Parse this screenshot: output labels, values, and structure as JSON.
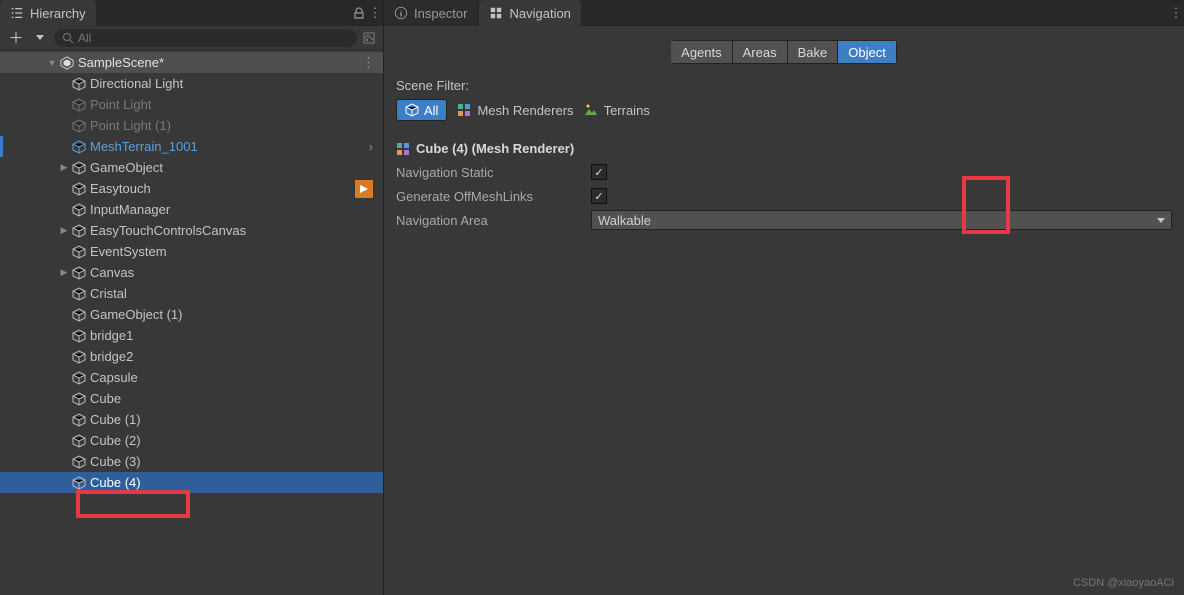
{
  "hierarchy": {
    "title": "Hierarchy",
    "search_placeholder": "All",
    "scene": "SampleScene*",
    "items": [
      {
        "label": "Directional Light",
        "indent": 2,
        "dim": false,
        "blue": false,
        "arrow": "",
        "mark": false
      },
      {
        "label": "Point Light",
        "indent": 2,
        "dim": true,
        "blue": false,
        "arrow": "",
        "mark": false
      },
      {
        "label": "Point Light (1)",
        "indent": 2,
        "dim": true,
        "blue": false,
        "arrow": "",
        "mark": false
      },
      {
        "label": "MeshTerrain_1001",
        "indent": 2,
        "dim": false,
        "blue": true,
        "arrow": "",
        "mark": true,
        "chev": true
      },
      {
        "label": "GameObject",
        "indent": 2,
        "dim": false,
        "blue": false,
        "arrow": "▶",
        "mark": false
      },
      {
        "label": "Easytouch",
        "indent": 2,
        "dim": false,
        "blue": false,
        "arrow": "",
        "mark": false,
        "ricon": true
      },
      {
        "label": "InputManager",
        "indent": 2,
        "dim": false,
        "blue": false,
        "arrow": "",
        "mark": false
      },
      {
        "label": "EasyTouchControlsCanvas",
        "indent": 2,
        "dim": false,
        "blue": false,
        "arrow": "▶",
        "mark": false
      },
      {
        "label": "EventSystem",
        "indent": 2,
        "dim": false,
        "blue": false,
        "arrow": "",
        "mark": false
      },
      {
        "label": "Canvas",
        "indent": 2,
        "dim": false,
        "blue": false,
        "arrow": "▶",
        "mark": false
      },
      {
        "label": "Cristal",
        "indent": 2,
        "dim": false,
        "blue": false,
        "arrow": "",
        "mark": false
      },
      {
        "label": "GameObject (1)",
        "indent": 2,
        "dim": false,
        "blue": false,
        "arrow": "",
        "mark": false
      },
      {
        "label": "bridge1",
        "indent": 2,
        "dim": false,
        "blue": false,
        "arrow": "",
        "mark": false
      },
      {
        "label": "bridge2",
        "indent": 2,
        "dim": false,
        "blue": false,
        "arrow": "",
        "mark": false
      },
      {
        "label": "Capsule",
        "indent": 2,
        "dim": false,
        "blue": false,
        "arrow": "",
        "mark": false
      },
      {
        "label": "Cube",
        "indent": 2,
        "dim": false,
        "blue": false,
        "arrow": "",
        "mark": false
      },
      {
        "label": "Cube (1)",
        "indent": 2,
        "dim": false,
        "blue": false,
        "arrow": "",
        "mark": false
      },
      {
        "label": "Cube (2)",
        "indent": 2,
        "dim": false,
        "blue": false,
        "arrow": "",
        "mark": false
      },
      {
        "label": "Cube (3)",
        "indent": 2,
        "dim": false,
        "blue": false,
        "arrow": "",
        "mark": false
      },
      {
        "label": "Cube (4)",
        "indent": 2,
        "dim": false,
        "blue": false,
        "arrow": "",
        "mark": false,
        "sel": true
      }
    ]
  },
  "inspector": {
    "tab_inspector": "Inspector",
    "tab_navigation": "Navigation",
    "nav_tabs": [
      "Agents",
      "Areas",
      "Bake",
      "Object"
    ],
    "nav_active": 3,
    "scene_filter_label": "Scene Filter:",
    "filters": {
      "all": "All",
      "mesh": "Mesh Renderers",
      "terrain": "Terrains"
    },
    "object_title": "Cube (4) (Mesh Renderer)",
    "prop_nav_static": "Navigation Static",
    "prop_gen_links": "Generate OffMeshLinks",
    "prop_nav_area": "Navigation Area",
    "nav_area_value": "Walkable",
    "check_nav_static": true,
    "check_gen_links": true
  },
  "watermark": "CSDN @xiaoyaoACi"
}
